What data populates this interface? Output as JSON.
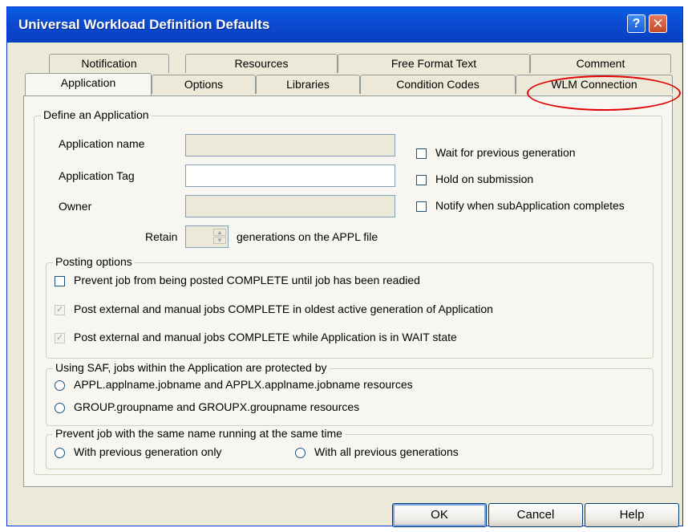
{
  "window": {
    "title": "Universal Workload Definition Defaults",
    "help_glyph": "?",
    "close_glyph": "✕"
  },
  "tabs": {
    "row1": [
      "Notification",
      "Resources",
      "Free Format Text",
      "Comment"
    ],
    "row2": [
      "Application",
      "Options",
      "Libraries",
      "Condition Codes",
      "WLM Connection"
    ],
    "active": "Application",
    "highlighted": "WLM Connection",
    "highlight_color": "#e00000"
  },
  "define": {
    "legend": "Define an Application",
    "app_name_label": "Application name",
    "app_name_value": "",
    "app_tag_label": "Application Tag",
    "app_tag_value": "",
    "owner_label": "Owner",
    "owner_value": "",
    "retain_label": "Retain",
    "retain_value": "",
    "retain_suffix": "generations on the APPL file",
    "checkboxes": [
      {
        "label": "Wait for previous generation",
        "checked": false
      },
      {
        "label": "Hold on submission",
        "checked": false
      },
      {
        "label": "Notify when subApplication completes",
        "checked": false
      }
    ]
  },
  "posting": {
    "legend": "Posting options",
    "options": [
      {
        "label": "Prevent job from being posted COMPLETE until job has been readied",
        "checked": false,
        "enabled": true
      },
      {
        "label": "Post external and manual jobs COMPLETE in oldest active generation of Application",
        "checked": true,
        "enabled": false
      },
      {
        "label": "Post external and manual jobs COMPLETE while Application is in WAIT state",
        "checked": true,
        "enabled": false
      }
    ]
  },
  "saf": {
    "legend": "Using SAF, jobs within the Application are protected by",
    "options": [
      "APPL.applname.jobname and APPLX.applname.jobname resources",
      "GROUP.groupname and GROUPX.groupname resources"
    ]
  },
  "prevent": {
    "legend": "Prevent job with the same name running at the same time",
    "options": [
      "With previous generation only",
      "With all previous generations"
    ]
  },
  "buttons": {
    "ok": "OK",
    "cancel": "Cancel",
    "help": "Help"
  },
  "colors": {
    "titlebar": "#0b4bd1",
    "dialog_bg": "#ece9d8",
    "panel_bg": "#f7f6f0"
  },
  "icons": {
    "help": "question-mark",
    "close": "x"
  }
}
